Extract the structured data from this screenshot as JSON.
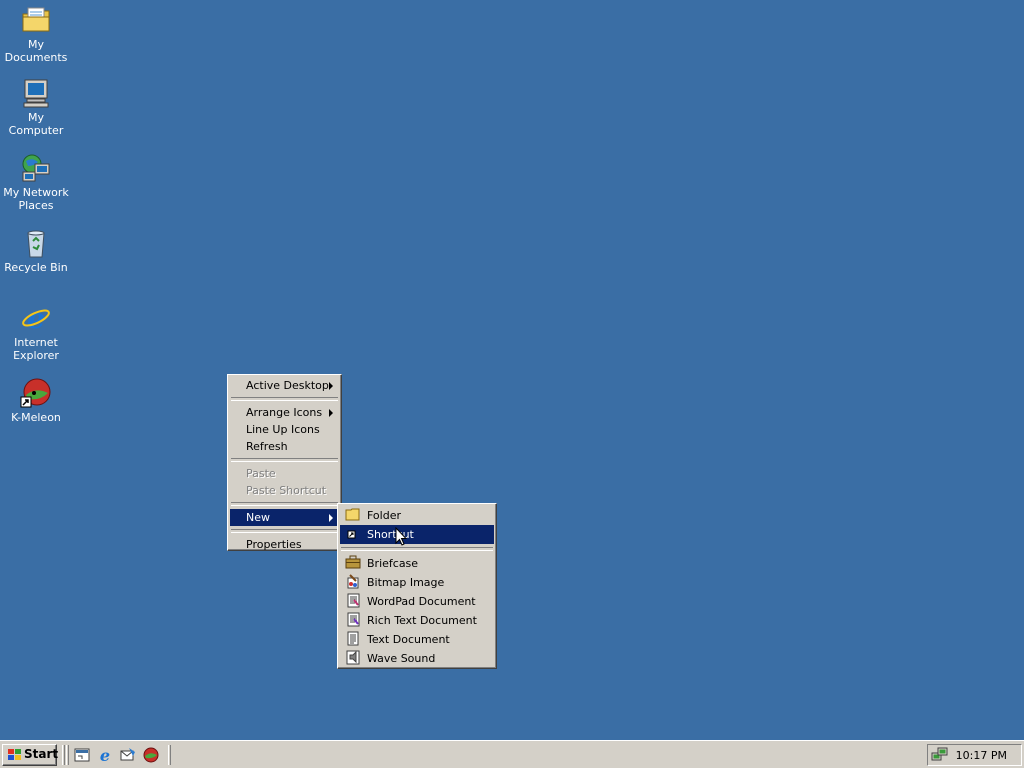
{
  "desktop": {
    "background_color": "#3a6ea5",
    "icons": [
      {
        "label": "My Documents",
        "icon": "folder-documents-icon"
      },
      {
        "label": "My Computer",
        "icon": "computer-icon"
      },
      {
        "label_line1": "My Network",
        "label_line2": "Places",
        "icon": "network-places-icon"
      },
      {
        "label": "Recycle Bin",
        "icon": "recycle-bin-icon"
      },
      {
        "label_line1": "Internet",
        "label_line2": "Explorer",
        "icon": "internet-explorer-icon"
      },
      {
        "label": "K-Meleon",
        "icon": "k-meleon-icon"
      }
    ]
  },
  "context_menu": {
    "items": [
      {
        "label": "Active Desktop",
        "submenu": true
      },
      {
        "label": "Arrange Icons",
        "submenu": true
      },
      {
        "label": "Line Up Icons"
      },
      {
        "label": "Refresh"
      },
      {
        "label": "Paste",
        "disabled": true
      },
      {
        "label": "Paste Shortcut",
        "disabled": true
      },
      {
        "label": "New",
        "submenu": true,
        "selected": true
      },
      {
        "label": "Properties"
      }
    ]
  },
  "new_submenu": {
    "items": [
      {
        "label": "Folder",
        "icon": "folder-icon"
      },
      {
        "label": "Shortcut",
        "icon": "shortcut-icon",
        "selected": true
      },
      {
        "label": "Briefcase",
        "icon": "briefcase-icon"
      },
      {
        "label": "Bitmap Image",
        "icon": "bitmap-image-icon"
      },
      {
        "label": "WordPad Document",
        "icon": "wordpad-document-icon"
      },
      {
        "label": "Rich Text Document",
        "icon": "rich-text-document-icon"
      },
      {
        "label": "Text Document",
        "icon": "text-document-icon"
      },
      {
        "label": "Wave Sound",
        "icon": "wave-sound-icon"
      }
    ]
  },
  "taskbar": {
    "start_label": "Start",
    "quick_launch": [
      "show-desktop-icon",
      "internet-explorer-icon",
      "outlook-express-icon",
      "k-meleon-icon"
    ],
    "clock": "10:17 PM",
    "selection_color": "#0a246a"
  }
}
